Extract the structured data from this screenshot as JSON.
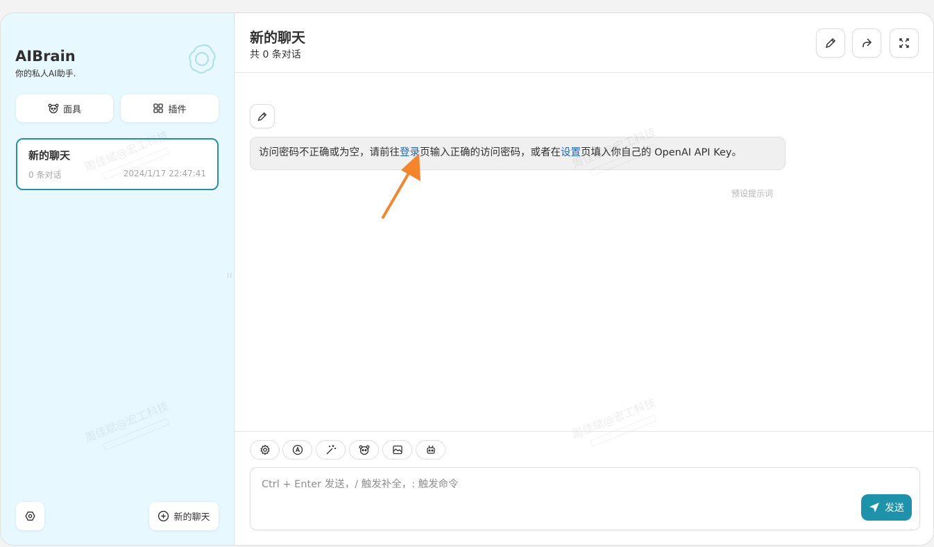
{
  "sidebar": {
    "title": "AIBrain",
    "subtitle": "你的私人AI助手.",
    "mask_button": "面具",
    "plugin_button": "插件",
    "chat_item": {
      "title": "新的聊天",
      "count": "0 条对话",
      "time": "2024/1/17 22:47:41"
    },
    "new_chat_button": "新的聊天"
  },
  "header": {
    "title": "新的聊天",
    "subtitle": "共 0 条对话"
  },
  "message": {
    "text_before": "访问密码不正确或为空，请前往",
    "link_login": "登录",
    "text_middle": "页输入正确的访问密码，或者在",
    "link_settings": "设置",
    "text_after": "页填入你自己的 OpenAI API Key。",
    "note": "预设提示词"
  },
  "watermark": "周佳斌@宏工科技",
  "input": {
    "placeholder": "Ctrl + Enter 发送，/ 触发补全，: 触发命令",
    "send_label": "发送"
  },
  "colors": {
    "accent": "#1d93ab",
    "sidebar_bg": "#e7f8ff",
    "link": "#1d65b8",
    "arrow": "#f5852a"
  }
}
